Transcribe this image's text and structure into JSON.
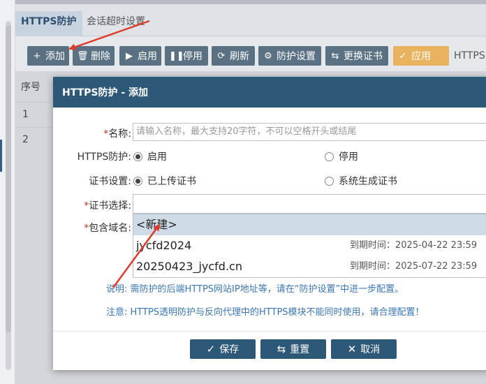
{
  "tabs": {
    "active": "HTTPS防护",
    "inactive": "会话超时设置"
  },
  "toolbar": {
    "buttons": [
      {
        "label": "添加",
        "icon": "plus-icon"
      },
      {
        "label": "删除",
        "icon": "trash-icon"
      },
      {
        "label": "启用",
        "icon": "play-icon"
      },
      {
        "label": "停用",
        "icon": "pause-icon"
      },
      {
        "label": "刷新",
        "icon": "refresh-icon"
      },
      {
        "label": "防护设置",
        "icon": "gear-icon"
      },
      {
        "label": "更换证书",
        "icon": "swap-icon"
      },
      {
        "label": "应用",
        "icon": "check-icon"
      }
    ],
    "trailing_text": "HTTPS"
  },
  "table": {
    "header_seq": "序号",
    "rows": [
      "1",
      "2"
    ]
  },
  "modal": {
    "title": "HTTPS防护 - 添加",
    "name_label": "名称:",
    "name_placeholder": "请输入名称，最大支持20字符，不可以空格开头或结尾",
    "https_label": "HTTPS防护:",
    "https_on": "启用",
    "https_off": "停用",
    "cert_setting_label": "证书设置:",
    "cert_uploaded": "已上传证书",
    "cert_system": "系统生成证书",
    "cert_select_label": "证书选择:",
    "domain_label": "包含域名:",
    "dropdown": [
      {
        "name": "<新建>",
        "expire": ""
      },
      {
        "name": "jycfd2024",
        "expire": "到期时间：2025-04-22 23:59"
      },
      {
        "name": "20250423_jycfd.cn",
        "expire": "到期时间：2025-07-22 23:59"
      }
    ],
    "note1": "说明: 需防护的后端HTTPS网站IP地址等，请在“防护设置”中进一步配置。",
    "note2": "注意: HTTPS透明防护与反向代理中的HTTPS模块不能同时使用，请合理配置！",
    "save": "保存",
    "reset": "重置",
    "cancel": "取消"
  },
  "colors": {
    "header": "#2e5878",
    "toolbar_button": "#5a7184",
    "apply_button": "#e8b25e",
    "annotation_arrow": "#e03a2a",
    "note_text": "#3a78b5"
  }
}
